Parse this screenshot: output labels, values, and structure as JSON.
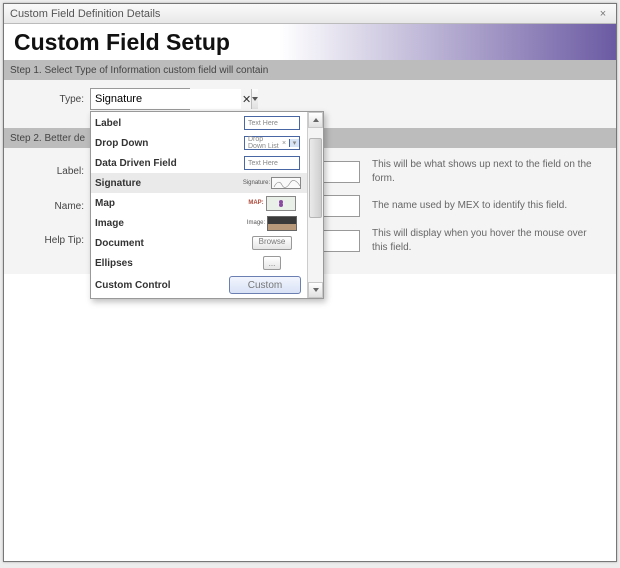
{
  "window": {
    "title": "Custom Field Definition Details"
  },
  "header": {
    "title": "Custom Field Setup"
  },
  "step1": {
    "bar": "Step 1. Select Type of Information custom field will contain",
    "type_label": "Type:",
    "type_value": "Signature"
  },
  "step2": {
    "bar": "Step 2. Better de",
    "label_label": "Label:",
    "label_value": "",
    "label_hint": "This will be what shows up next to the field on the form.",
    "name_label": "Name:",
    "name_value": "",
    "name_hint": "The name used by MEX to identify this field.",
    "help_label": "Help Tip:",
    "help_value": "",
    "help_hint": "This will display when you hover the mouse over this field."
  },
  "dropdown": {
    "preview_text_here": "Text Here",
    "preview_dd": "Drop Down List",
    "preview_sig_label": "Signature:",
    "preview_map_label": "MAP:",
    "preview_img_label": "Image:",
    "preview_browse": "Browse",
    "preview_custom": "Custom",
    "items": [
      {
        "label": "Label"
      },
      {
        "label": "Drop Down"
      },
      {
        "label": "Data Driven Field"
      },
      {
        "label": "Signature"
      },
      {
        "label": "Map"
      },
      {
        "label": "Image"
      },
      {
        "label": "Document"
      },
      {
        "label": "Ellipses"
      },
      {
        "label": "Custom Control"
      }
    ]
  }
}
